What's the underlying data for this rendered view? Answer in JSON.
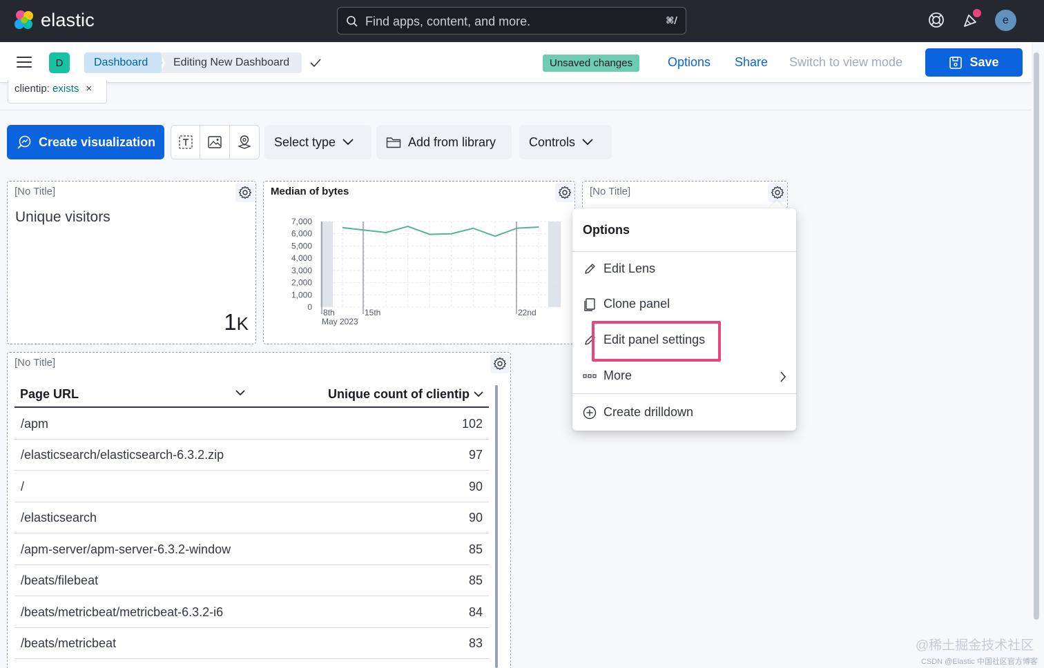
{
  "app": {
    "logo_text": "elastic",
    "search_placeholder": "Find apps, content, and more.",
    "search_shortcut": "⌘/",
    "avatar_initial": "e"
  },
  "subheader": {
    "space_initial": "D",
    "breadcrumbs": [
      "Dashboard",
      "Editing New Dashboard"
    ],
    "unsaved_badge": "Unsaved changes",
    "options_label": "Options",
    "share_label": "Share",
    "switch_label": "Switch to view mode",
    "save_label": "Save"
  },
  "filter": {
    "key": "clientip:",
    "value": "exists",
    "remove_glyph": "×"
  },
  "toolbar": {
    "create_label": "Create visualization",
    "select_type_label": "Select type",
    "add_library_label": "Add from library",
    "controls_label": "Controls"
  },
  "panels": {
    "metric": {
      "title": "[No Title]",
      "label": "Unique visitors",
      "value": "1",
      "value_suffix": "K"
    },
    "chart": {
      "title": "Median of bytes"
    },
    "third": {
      "title": "[No Title]"
    },
    "table": {
      "title": "[No Title]",
      "col1": "Page URL",
      "col2": "Unique count of clientip",
      "rows": [
        {
          "url": "/apm",
          "count": "102"
        },
        {
          "url": "/elasticsearch/elasticsearch-6.3.2.zip",
          "count": "97"
        },
        {
          "url": "/",
          "count": "90"
        },
        {
          "url": "/elasticsearch",
          "count": "90"
        },
        {
          "url": "/apm-server/apm-server-6.3.2-window",
          "count": "85"
        },
        {
          "url": "/beats/filebeat",
          "count": "85"
        },
        {
          "url": "/beats/metricbeat/metricbeat-6.3.2-i6",
          "count": "84"
        },
        {
          "url": "/beats/metricbeat",
          "count": "83"
        }
      ]
    }
  },
  "chart_data": {
    "type": "line",
    "title": "Median of bytes",
    "ylim": [
      0,
      7000
    ],
    "y_ticks": [
      "7,000",
      "6,000",
      "5,000",
      "4,000",
      "3,000",
      "2,000",
      "1,000",
      "0"
    ],
    "x_ticks": [
      "8th",
      "15th",
      "22nd"
    ],
    "x_sub_label": "May 2023",
    "series": [
      {
        "values": [
          6500,
          6300,
          6100,
          6600,
          5950,
          6000,
          6450,
          5800,
          6450,
          6550
        ]
      }
    ],
    "grid": true,
    "line_color": "#54b399"
  },
  "menu": {
    "title": "Options",
    "items": [
      "Edit Lens",
      "Clone panel",
      "Edit panel settings",
      "More",
      "Create drilldown"
    ]
  },
  "watermark": {
    "line1": "@稀土掘金技术社区",
    "line2": "CSDN @Elastic 中国社区官方博客"
  }
}
